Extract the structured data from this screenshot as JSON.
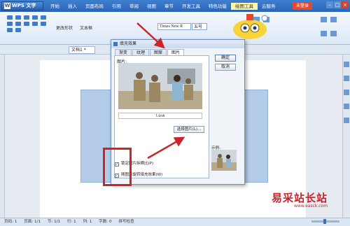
{
  "app": {
    "title": "WPS 文字"
  },
  "menu_tabs": [
    "开始",
    "插入",
    "页面布局",
    "引用",
    "审阅",
    "视图",
    "章节",
    "开发工具",
    "特色功能",
    "绘图工具",
    "云服务"
  ],
  "ribbon": {
    "edit_shape": "更改形状",
    "text_box": "文本框",
    "font": "Times New R",
    "size": "五号",
    "register_label": "未登录"
  },
  "document_tab": "文档1 *",
  "dialog": {
    "title": "填充效果",
    "tabs": [
      "渐变",
      "纹理",
      "图案",
      "图片"
    ],
    "active_tab": "图片",
    "picture_label": "图片:",
    "filename": "link",
    "select_picture_button": "选择图片(L)...",
    "ok_button": "确定",
    "cancel_button": "取消",
    "sample_label": "示例:",
    "lock_aspect": {
      "label": "锁定图片纵横比(P)",
      "checked": true
    },
    "rotate_with_shape": {
      "label": "随图形旋转填充效果(W)",
      "checked": true
    }
  },
  "status_bar": [
    "页码: 1",
    "页面: 1/1",
    "节: 1/1",
    "行: 1",
    "列: 1",
    "字数: 0",
    "拼写检查"
  ],
  "watermark": {
    "text": "易采站长站",
    "url": "www.easck.com"
  },
  "colors": {
    "accent": "#2b64b8",
    "highlight": "#c9252b",
    "shape_fill": "#b4cce8"
  }
}
